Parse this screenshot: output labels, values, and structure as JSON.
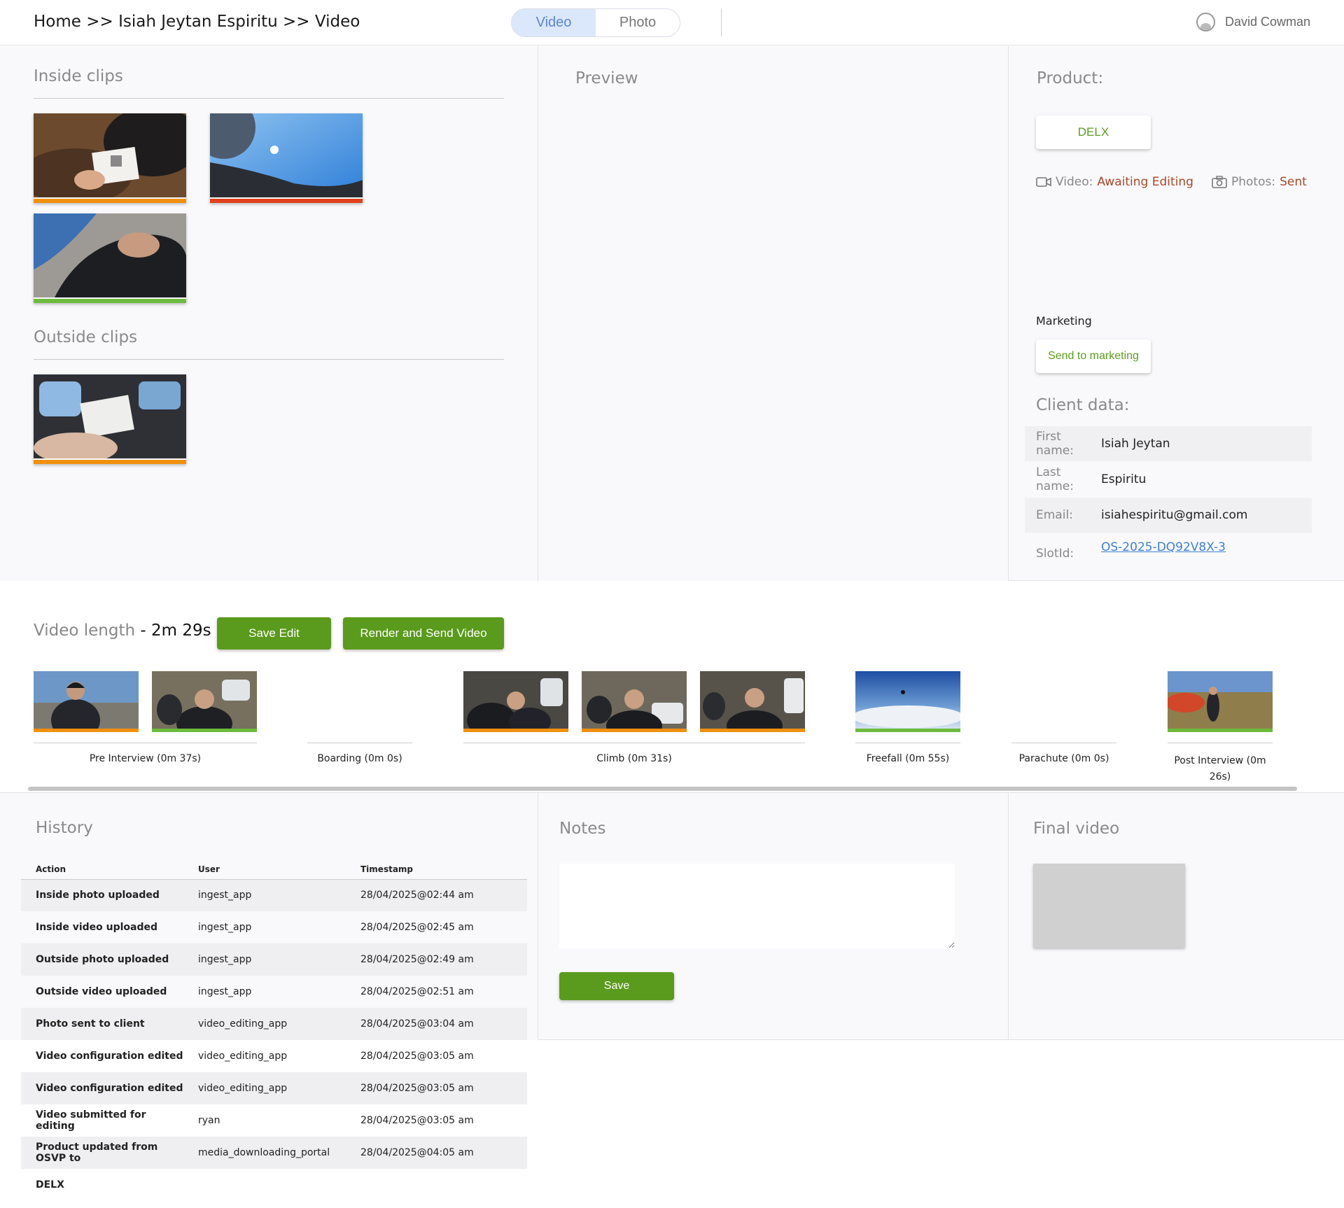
{
  "header": {
    "breadcrumb": "Home >> Isiah Jeytan Espiritu >> Video",
    "tabs": [
      "Video",
      "Photo"
    ],
    "user_name": "David Cowman"
  },
  "clips": {
    "inside_title": "Inside clips",
    "outside_title": "Outside clips",
    "inside": [
      {
        "scene": "hand holding QR card",
        "status_color": "#f0900e"
      },
      {
        "scene": "blue sky selfie",
        "status_color": "#e0401c"
      },
      {
        "scene": "freefall close-up",
        "status_color": "#6cbb3c"
      }
    ],
    "outside": [
      {
        "scene": "hand holding QR card in plane",
        "status_color": "#f0900e"
      }
    ]
  },
  "preview": {
    "title": "Preview"
  },
  "product": {
    "title": "Product:",
    "button": "DELX",
    "video_label": "Video:",
    "video_status": "Awaiting Editing",
    "photos_label": "Photos:",
    "photos_status": "Sent",
    "marketing_label": "Marketing",
    "marketing_button": "Send to marketing"
  },
  "client": {
    "title": "Client data:",
    "rows": [
      {
        "key": "First name:",
        "value": "Isiah Jeytan"
      },
      {
        "key": "Last name:",
        "value": "Espiritu"
      },
      {
        "key": "Email:",
        "value": "isiahespiritu@gmail.com"
      },
      {
        "key": "SlotId:",
        "value": "OS-2025-DQ92V8X-3"
      }
    ]
  },
  "editor": {
    "length_label": "Video length",
    "length_value": "- 2m 29s",
    "save_edit": "Save Edit",
    "render_send": "Render and Send Video",
    "segments": [
      {
        "label": "Pre Interview (0m 37s)"
      },
      {
        "label": "Boarding (0m 0s)"
      },
      {
        "label": "Climb (0m 31s)"
      },
      {
        "label": "Freefall (0m 55s)"
      },
      {
        "label": "Parachute (0m 0s)"
      },
      {
        "label": "Post Interview (0m 26s)"
      }
    ],
    "segment_clip_colors": {
      "orange": "#f0900e",
      "green": "#6cbb3c"
    }
  },
  "history": {
    "title": "History",
    "columns": [
      "Action",
      "User",
      "Timestamp"
    ],
    "rows": [
      {
        "action": "Inside photo uploaded",
        "user": "ingest_app",
        "timestamp": "28/04/2025@02:44 am"
      },
      {
        "action": "Inside video uploaded",
        "user": "ingest_app",
        "timestamp": "28/04/2025@02:45 am"
      },
      {
        "action": "Outside photo uploaded",
        "user": "ingest_app",
        "timestamp": "28/04/2025@02:49 am"
      },
      {
        "action": "Outside video uploaded",
        "user": "ingest_app",
        "timestamp": "28/04/2025@02:51 am"
      },
      {
        "action": "Photo sent to client",
        "user": "video_editing_app",
        "timestamp": "28/04/2025@03:04 am"
      },
      {
        "action": "Video configuration edited",
        "user": "video_editing_app",
        "timestamp": "28/04/2025@03:05 am"
      },
      {
        "action": "Video configuration edited",
        "user": "video_editing_app",
        "timestamp": "28/04/2025@03:05 am"
      },
      {
        "action": "Video submitted for editing",
        "user": "ryan",
        "timestamp": "28/04/2025@03:05 am"
      },
      {
        "action": "Product updated from OSVP to",
        "user": "media_downloading_portal",
        "timestamp": "28/04/2025@04:05 am"
      },
      {
        "action": "DELX",
        "user": "",
        "timestamp": ""
      }
    ]
  },
  "notes": {
    "title": "Notes",
    "value": "",
    "save": "Save"
  },
  "final_video": {
    "title": "Final video"
  }
}
